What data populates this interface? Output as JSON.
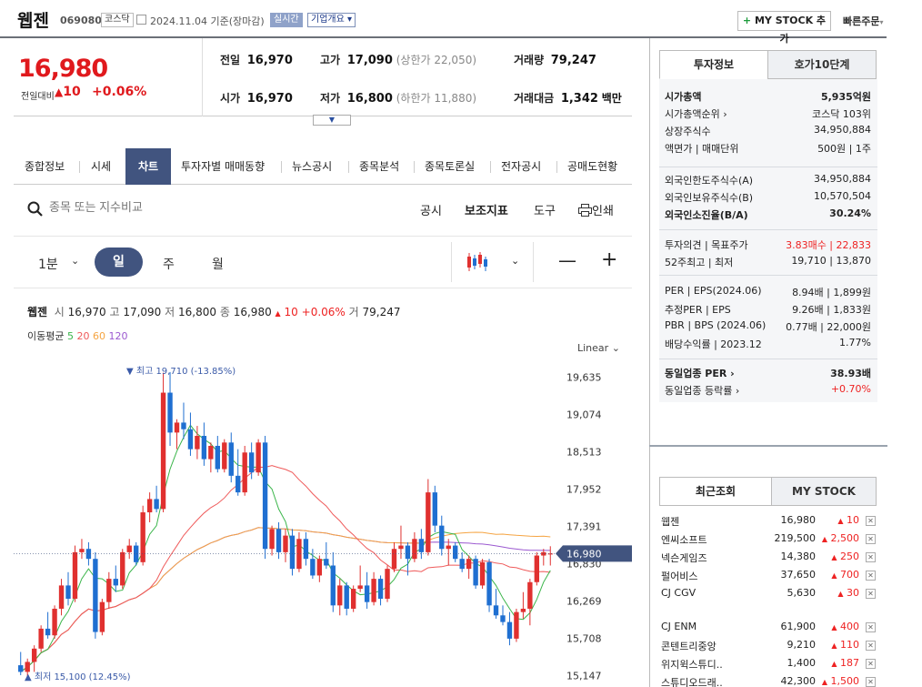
{
  "header": {
    "name": "웹젠",
    "code": "069080",
    "market": "코스닥",
    "date": "2024.11.04 기준(장마감)",
    "realtime": "실시간",
    "company_info": "기업개요",
    "mystock_plus": "+",
    "mystock": "MY STOCK 추가",
    "quick_order": "빠른주문"
  },
  "price": {
    "current": "16,980",
    "change_label": "전일대비",
    "change": "10",
    "change_pct": "+0.06%",
    "prev_label": "전일",
    "prev": "16,970",
    "high_label": "고가",
    "high": "17,090",
    "upper": "(상한가 22,050)",
    "volume_label": "거래량",
    "volume": "79,247",
    "open_label": "시가",
    "open": "16,970",
    "low_label": "저가",
    "low": "16,800",
    "lower": "(하한가 11,880)",
    "amount_label": "거래대금",
    "amount": "1,342",
    "amount_unit": "백만"
  },
  "tabs": [
    "종합정보",
    "시세",
    "차트",
    "투자자별 매매동향",
    "뉴스공시",
    "종목분석",
    "종목토론실",
    "전자공시",
    "공매도현황"
  ],
  "toolbar": {
    "search_placeholder": "종목 또는 지수비교",
    "disclosure": "공시",
    "indicators": "보조지표",
    "tools": "도구",
    "print": "인쇄"
  },
  "period": {
    "minute": "1분",
    "day": "일",
    "week": "주",
    "month": "월"
  },
  "chart_info": {
    "name": "웹젠",
    "open_l": "시",
    "open": "16,970",
    "high_l": "고",
    "high": "17,090",
    "low_l": "저",
    "low": "16,800",
    "close_l": "종",
    "close": "16,980",
    "chg": "10",
    "pct": "+0.06%",
    "vol_l": "거",
    "vol": "79,247",
    "ma_label": "이동평균",
    "ma5": "5",
    "ma20": "20",
    "ma60": "60",
    "ma120": "120",
    "scale": "Linear",
    "max_label": "▼ 최고 19,710 (-13.85%)",
    "min_label": "▲ 최저 15,100 (12.45%)",
    "cur_tag": "16,980"
  },
  "chart_data": {
    "type": "candlestick",
    "y_ticks": [
      19635,
      19074,
      18513,
      17952,
      17391,
      16830,
      16269,
      15708,
      15147
    ],
    "y_tick_labels": [
      "19,635",
      "19,074",
      "18,513",
      "17,952",
      "17,391",
      "16,830",
      "16,269",
      "15,708",
      "15,147"
    ],
    "ylim": [
      15000,
      19900
    ],
    "colors": {
      "up": "#e0302f",
      "down": "#1f6fd1",
      "ma5": "#3ab54a",
      "ma20": "#ef5a5a",
      "ma60": "#f5a442",
      "ma120": "#9b59d0"
    },
    "candles": [
      [
        15300,
        15500,
        15150,
        15200
      ],
      [
        15200,
        15400,
        15100,
        15350
      ],
      [
        15350,
        15600,
        15200,
        15550
      ],
      [
        15550,
        15900,
        15500,
        15850
      ],
      [
        15850,
        16100,
        15700,
        15750
      ],
      [
        15750,
        16200,
        15700,
        16150
      ],
      [
        16150,
        16600,
        16050,
        16500
      ],
      [
        16500,
        16700,
        16200,
        16300
      ],
      [
        16300,
        17100,
        16250,
        17000
      ],
      [
        17000,
        17200,
        16900,
        17050
      ],
      [
        17050,
        17150,
        16800,
        16900
      ],
      [
        16900,
        17000,
        15700,
        15800
      ],
      [
        15800,
        16300,
        15750,
        16250
      ],
      [
        16250,
        16700,
        16150,
        16600
      ],
      [
        16600,
        16800,
        16400,
        16500
      ],
      [
        16500,
        17050,
        16450,
        17000
      ],
      [
        17000,
        17200,
        16900,
        17100
      ],
      [
        17100,
        17150,
        16800,
        16850
      ],
      [
        16850,
        17700,
        16800,
        17600
      ],
      [
        17600,
        17900,
        17450,
        17800
      ],
      [
        17800,
        18000,
        17600,
        17650
      ],
      [
        17650,
        19700,
        17600,
        19400
      ],
      [
        19400,
        19710,
        18600,
        18800
      ],
      [
        18800,
        19000,
        18550,
        18950
      ],
      [
        18950,
        19250,
        18700,
        18850
      ],
      [
        18850,
        19100,
        18450,
        18550
      ],
      [
        18550,
        18900,
        18400,
        18750
      ],
      [
        18750,
        18950,
        18300,
        18400
      ],
      [
        18400,
        18650,
        18200,
        18600
      ],
      [
        18600,
        18750,
        18200,
        18250
      ],
      [
        18250,
        18700,
        18200,
        18650
      ],
      [
        18650,
        18800,
        18050,
        18150
      ],
      [
        18150,
        18550,
        17850,
        17900
      ],
      [
        17900,
        18600,
        17850,
        18500
      ],
      [
        18500,
        18650,
        18100,
        18200
      ],
      [
        18200,
        18700,
        18150,
        18650
      ],
      [
        18650,
        18750,
        16900,
        17050
      ],
      [
        17050,
        17400,
        16950,
        17350
      ],
      [
        17350,
        17450,
        16900,
        17000
      ],
      [
        17000,
        17350,
        16850,
        17250
      ],
      [
        17250,
        17350,
        16650,
        16750
      ],
      [
        16750,
        17300,
        16700,
        17200
      ],
      [
        17200,
        17300,
        16800,
        16900
      ],
      [
        16900,
        17050,
        16600,
        16650
      ],
      [
        16650,
        16950,
        16550,
        16900
      ],
      [
        16900,
        17150,
        16750,
        16800
      ],
      [
        16800,
        17000,
        16100,
        16200
      ],
      [
        16200,
        16600,
        16050,
        16500
      ],
      [
        16500,
        16550,
        16050,
        16150
      ],
      [
        16150,
        16500,
        16100,
        16450
      ],
      [
        16450,
        16800,
        16400,
        16500
      ],
      [
        16500,
        16700,
        16150,
        16250
      ],
      [
        16250,
        16700,
        16200,
        16600
      ],
      [
        16600,
        16650,
        16200,
        16300
      ],
      [
        16300,
        16800,
        16250,
        16750
      ],
      [
        16750,
        17150,
        16700,
        17050
      ],
      [
        17050,
        17400,
        16900,
        17100
      ],
      [
        17100,
        17150,
        16650,
        16900
      ],
      [
        16900,
        17300,
        16850,
        17200
      ],
      [
        17200,
        17350,
        16900,
        17000
      ],
      [
        17000,
        18100,
        16950,
        17900
      ],
      [
        17900,
        18000,
        17300,
        17400
      ],
      [
        17400,
        17550,
        16950,
        17050
      ],
      [
        17050,
        17200,
        16800,
        17100
      ],
      [
        17100,
        17150,
        16850,
        16900
      ],
      [
        16900,
        17000,
        16700,
        16750
      ],
      [
        16750,
        16950,
        16600,
        16900
      ],
      [
        16900,
        16950,
        16450,
        16500
      ],
      [
        16500,
        16900,
        16450,
        16850
      ],
      [
        16850,
        16900,
        16100,
        16200
      ],
      [
        16200,
        16450,
        16000,
        16050
      ],
      [
        16050,
        16200,
        15900,
        15950
      ],
      [
        15950,
        16100,
        15600,
        15700
      ],
      [
        15700,
        16150,
        15650,
        16100
      ],
      [
        16100,
        16400,
        16000,
        16150
      ],
      [
        16150,
        16600,
        15900,
        16550
      ],
      [
        16550,
        17000,
        16500,
        16950
      ],
      [
        16950,
        17050,
        16800,
        17000
      ],
      [
        16970,
        17090,
        16800,
        16980
      ]
    ]
  },
  "invest": {
    "tab_on": "투자정보",
    "tab_off": "호가10단계",
    "rows1": [
      {
        "l": "시가총액",
        "v": "5,935억원"
      },
      {
        "l": "시가총액순위 ›",
        "v": "코스닥 103위"
      },
      {
        "l": "상장주식수",
        "v": "34,950,884"
      },
      {
        "l": "액면가 | 매매단위",
        "v": "500원 | 1주"
      }
    ],
    "rows2": [
      {
        "l": "외국인한도주식수(A)",
        "v": "34,950,884"
      },
      {
        "l": "외국인보유주식수(B)",
        "v": "10,570,504"
      },
      {
        "l": "외국인소진율(B/A)",
        "v": "30.24%"
      }
    ],
    "rows3": [
      {
        "l": "투자의견 | 목표주가",
        "v": "3.83매수 | 22,833"
      },
      {
        "l": "52주최고 | 최저",
        "v": "19,710 | 13,870"
      }
    ],
    "rows4": [
      {
        "l": "PER | EPS(2024.06)",
        "v": "8.94배 | 1,899원"
      },
      {
        "l": "추정PER | EPS",
        "v": "9.26배 | 1,833원"
      },
      {
        "l": "PBR | BPS (2024.06)",
        "v": "0.77배 | 22,000원"
      },
      {
        "l": "배당수익률 | 2023.12",
        "v": "1.77%"
      }
    ],
    "rows5": [
      {
        "l": "동일업종 PER ›",
        "v": "38.93배"
      },
      {
        "l": "동일업종 등락률 ›",
        "v": "+0.70%"
      }
    ]
  },
  "recent": {
    "tab_on": "최근조회",
    "tab_off": "MY STOCK",
    "items1": [
      {
        "n": "웹젠",
        "p": "16,980",
        "c": "10"
      },
      {
        "n": "엔씨소프트",
        "p": "219,500",
        "c": "2,500"
      },
      {
        "n": "넥슨게임즈",
        "p": "14,380",
        "c": "250"
      },
      {
        "n": "펄어비스",
        "p": "37,650",
        "c": "700"
      },
      {
        "n": "CJ CGV",
        "p": "5,630",
        "c": "30"
      }
    ],
    "items2": [
      {
        "n": "CJ ENM",
        "p": "61,900",
        "c": "400"
      },
      {
        "n": "콘텐트리중앙",
        "p": "9,210",
        "c": "110"
      },
      {
        "n": "위지윅스튜디..",
        "p": "1,400",
        "c": "187"
      },
      {
        "n": "스튜디오드래..",
        "p": "42,300",
        "c": "1,500"
      }
    ]
  }
}
